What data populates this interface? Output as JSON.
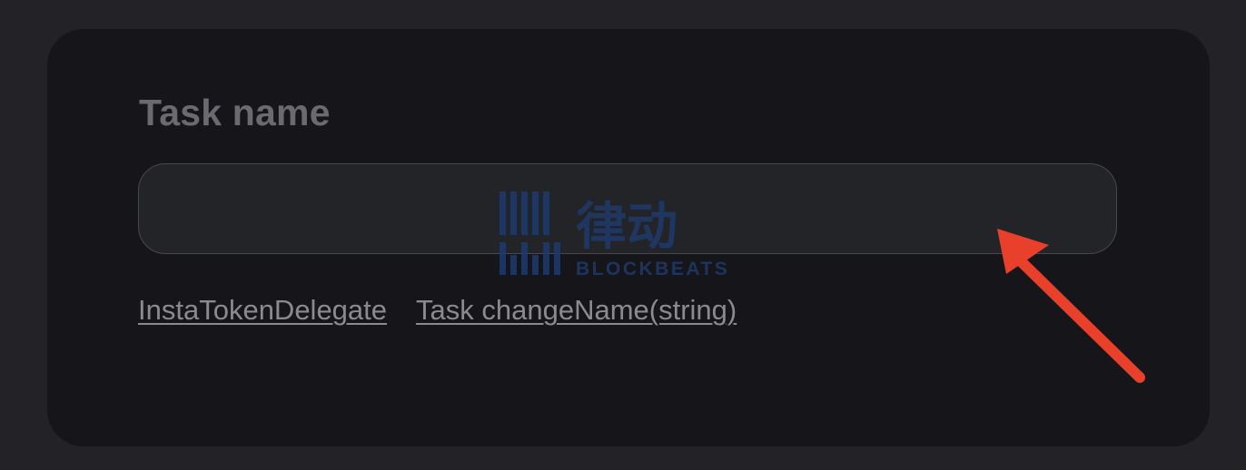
{
  "form": {
    "label": "Task name",
    "input_value": "",
    "input_placeholder": ""
  },
  "links": [
    {
      "label": "InstaTokenDelegate"
    },
    {
      "label": "Task changeName(string)"
    }
  ],
  "watermark": {
    "cn_text": "律动",
    "en_text": "BLOCKBEATS"
  },
  "colors": {
    "page_bg": "#232227",
    "card_bg": "#16161a",
    "input_bg": "#232428",
    "input_border": "#47484d",
    "label": "#6a6a70",
    "link": "#8a8a90",
    "arrow": "#e8402a",
    "watermark": "#1f3a6b"
  }
}
